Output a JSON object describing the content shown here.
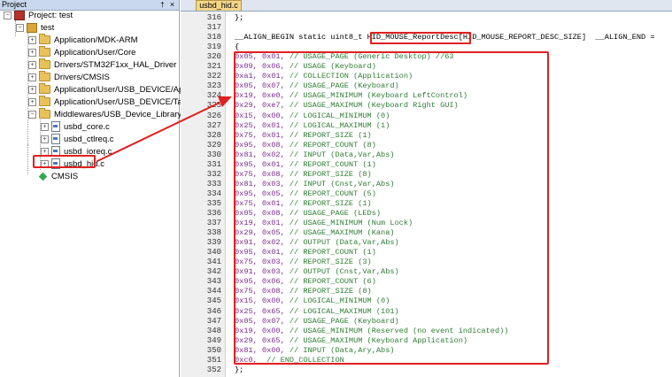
{
  "panel": {
    "title": "Project",
    "pin_glyph": "†",
    "close_glyph": "×",
    "tree": [
      {
        "label": "Project: test",
        "icon": "project-icon",
        "expander": "−"
      },
      {
        "label": "test",
        "icon": "target-icon",
        "expander": "−"
      },
      {
        "label": "Application/MDK-ARM",
        "icon": "folder-icon",
        "expander": "+"
      },
      {
        "label": "Application/User/Core",
        "icon": "folder-icon",
        "expander": "+"
      },
      {
        "label": "Drivers/STM32F1xx_HAL_Driver",
        "icon": "folder-icon",
        "expander": "+"
      },
      {
        "label": "Drivers/CMSIS",
        "icon": "folder-icon",
        "expander": "+"
      },
      {
        "label": "Application/User/USB_DEVICE/App",
        "icon": "folder-icon",
        "expander": "+"
      },
      {
        "label": "Application/User/USB_DEVICE/Target",
        "icon": "folder-icon",
        "expander": "+"
      },
      {
        "label": "Middlewares/USB_Device_Library",
        "icon": "folder-icon",
        "expander": "−"
      },
      {
        "label": "usbd_core.c",
        "icon": "file-icon",
        "expander": "+"
      },
      {
        "label": "usbd_ctlreq.c",
        "icon": "file-icon",
        "expander": "+"
      },
      {
        "label": "usbd_ioreq.c",
        "icon": "file-icon",
        "expander": "+"
      },
      {
        "label": "usbd_hid.c",
        "icon": "file-icon",
        "expander": "+"
      },
      {
        "label": "CMSIS",
        "icon": "cmsis-icon",
        "expander": ""
      }
    ]
  },
  "editor": {
    "tab_label": "usbd_hid.c",
    "header_lines": [
      {
        "no": "316",
        "text": "};"
      },
      {
        "no": "317",
        "text": ""
      },
      {
        "no": "318",
        "pre": "__ALIGN_BEGIN static uint8_t ",
        "name": "HID_MOUSE_ReportDesc",
        "post": "[HID_MOUSE_REPORT_DESC_SIZE]  __ALIGN_END ="
      },
      {
        "no": "319",
        "text": "{"
      }
    ],
    "code_lines": [
      {
        "no": "320",
        "hex": "0x05, 0x01,",
        "cmt": " // USAGE_PAGE (Generic Desktop) //63"
      },
      {
        "no": "321",
        "hex": "0x09, 0x06,",
        "cmt": " // USAGE (Keyboard)"
      },
      {
        "no": "322",
        "hex": "0xa1, 0x01,",
        "cmt": " // COLLECTION (Application)"
      },
      {
        "no": "323",
        "hex": "0x05, 0x07,",
        "cmt": " // USAGE_PAGE (Keyboard)"
      },
      {
        "no": "324",
        "hex": "0x19, 0xe0,",
        "cmt": " // USAGE_MINIMUM (Keyboard LeftControl)"
      },
      {
        "no": "325",
        "hex": "0x29, 0xe7,",
        "cmt": " // USAGE_MAXIMUM (Keyboard Right GUI)"
      },
      {
        "no": "326",
        "hex": "0x15, 0x00,",
        "cmt": " // LOGICAL_MINIMUM (0)"
      },
      {
        "no": "327",
        "hex": "0x25, 0x01,",
        "cmt": " // LOGICAL_MAXIMUM (1)"
      },
      {
        "no": "328",
        "hex": "0x75, 0x01,",
        "cmt": " // REPORT_SIZE (1)"
      },
      {
        "no": "329",
        "hex": "0x95, 0x08,",
        "cmt": " // REPORT_COUNT (8)"
      },
      {
        "no": "330",
        "hex": "0x81, 0x02,",
        "cmt": " // INPUT (Data,Var,Abs)"
      },
      {
        "no": "331",
        "hex": "0x95, 0x01,",
        "cmt": " // REPORT_COUNT (1)"
      },
      {
        "no": "332",
        "hex": "0x75, 0x08,",
        "cmt": " // REPORT_SIZE (8)"
      },
      {
        "no": "333",
        "hex": "0x81, 0x03,",
        "cmt": " // INPUT (Cnst,Var,Abs)"
      },
      {
        "no": "334",
        "hex": "0x95, 0x05,",
        "cmt": " // REPORT_COUNT (5)"
      },
      {
        "no": "335",
        "hex": "0x75, 0x01,",
        "cmt": " // REPORT_SIZE (1)"
      },
      {
        "no": "336",
        "hex": "0x05, 0x08,",
        "cmt": " // USAGE_PAGE (LEDs)"
      },
      {
        "no": "337",
        "hex": "0x19, 0x01,",
        "cmt": " // USAGE_MINIMUM (Num Lock)"
      },
      {
        "no": "338",
        "hex": "0x29, 0x05,",
        "cmt": " // USAGE_MAXIMUM (Kana)"
      },
      {
        "no": "339",
        "hex": "0x91, 0x02,",
        "cmt": " // OUTPUT (Data,Var,Abs)"
      },
      {
        "no": "340",
        "hex": "0x95, 0x01,",
        "cmt": " // REPORT_COUNT (1)"
      },
      {
        "no": "341",
        "hex": "0x75, 0x03,",
        "cmt": " // REPORT_SIZE (3)"
      },
      {
        "no": "342",
        "hex": "0x91, 0x03,",
        "cmt": " // OUTPUT (Cnst,Var,Abs)"
      },
      {
        "no": "343",
        "hex": "0x95, 0x06,",
        "cmt": " // REPORT_COUNT (6)"
      },
      {
        "no": "344",
        "hex": "0x75, 0x08,",
        "cmt": " // REPORT_SIZE (8)"
      },
      {
        "no": "345",
        "hex": "0x15, 0x00,",
        "cmt": " // LOGICAL_MINIMUM (0)"
      },
      {
        "no": "346",
        "hex": "0x25, 0x65,",
        "cmt": " // LOGICAL_MAXIMUM (101)"
      },
      {
        "no": "347",
        "hex": "0x05, 0x07,",
        "cmt": " // USAGE_PAGE (Keyboard)"
      },
      {
        "no": "348",
        "hex": "0x19, 0x00,",
        "cmt": " // USAGE_MINIMUM (Reserved (no event indicated))"
      },
      {
        "no": "349",
        "hex": "0x29, 0x65,",
        "cmt": " // USAGE_MAXIMUM (Keyboard Application)"
      },
      {
        "no": "350",
        "hex": "0x81, 0x00,",
        "cmt": " // INPUT (Data,Ary,Abs)"
      },
      {
        "no": "351",
        "hex": "0xc0,",
        "cmt": "  // END_COLLECTION"
      }
    ],
    "footer_lines": [
      {
        "no": "352",
        "text": "};"
      }
    ]
  },
  "colors": {
    "highlight": "#e02020",
    "hex_value": "#7a2a8f",
    "comment": "#2e7d32"
  }
}
